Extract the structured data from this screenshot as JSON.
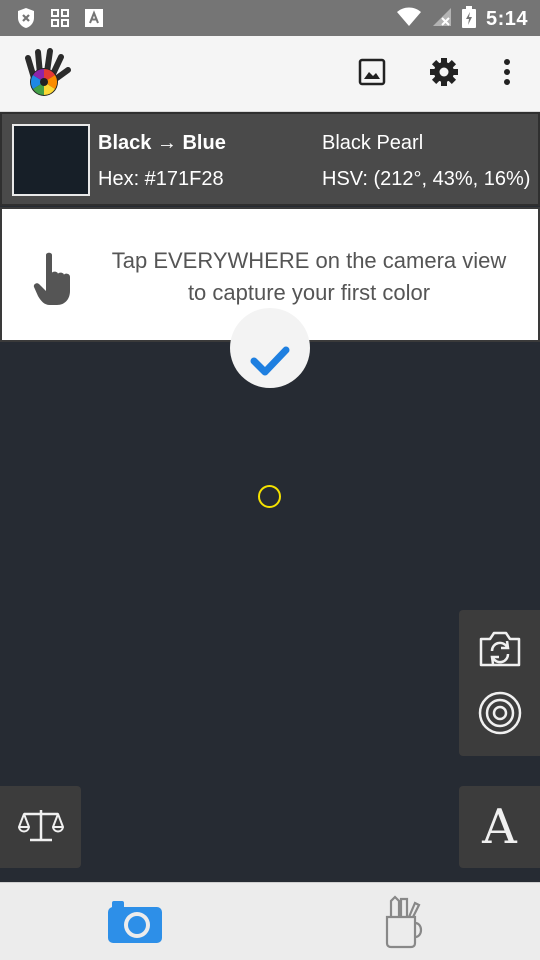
{
  "status_bar": {
    "time": "5:14",
    "icons": [
      "x-shield-icon",
      "apps-grid-icon",
      "text-a-icon",
      "wifi-icon",
      "no-signal-icon",
      "battery-charging-icon"
    ]
  },
  "app_bar": {
    "logo": "hand-color-wheel-logo",
    "actions": [
      "image-gallery-icon",
      "gear-icon",
      "more-vertical-icon"
    ]
  },
  "color_info": {
    "swatch_color": "#171F28",
    "name": "Black → Blue",
    "hex_text": "Hex: #171F28",
    "named_color": "Black Pearl",
    "hsv_text": "HSV: (212°, 43%, 16%)"
  },
  "hint": {
    "icon": "pointing-hand-icon",
    "line1": "Tap EVERYWHERE on the camera view",
    "line2": "to capture your first color"
  },
  "camera_view": {
    "background": "#262B33",
    "confirm_icon": "checkmark-icon",
    "target_color": "#F5E200"
  },
  "side_controls": {
    "switch_camera": "switch-camera-icon",
    "target_mode": "concentric-circles-icon",
    "font_label": "A",
    "compare": "scale-balance-icon"
  },
  "bottom_nav": {
    "accent": "#2D8FE8",
    "items": [
      "camera-icon",
      "tools-cup-icon"
    ]
  }
}
